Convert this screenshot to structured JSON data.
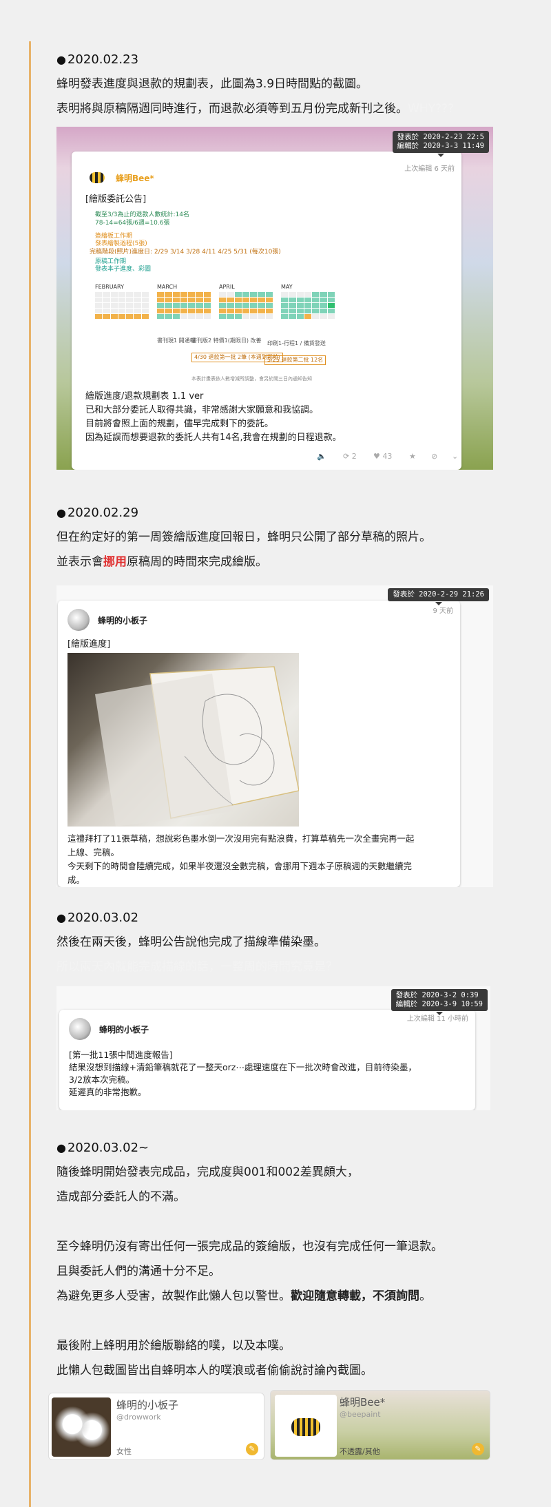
{
  "sections": [
    {
      "date": "2020.02.23",
      "lines": [
        "蜂明發表進度與退款的規劃表，此圖為3.9日時間點的截圖。",
        "表明將與原稿隔週同時進行，而退款必須等到五月份完成新刊之後。"
      ],
      "whisper": "WHY???"
    },
    {
      "date": "2020.02.29",
      "line1": "但在約定好的第一周簽繪版進度回報日，蜂明只公開了部分草稿的照片。",
      "line2_pre": "並表示會",
      "line2_red": "挪用",
      "line2_post": "原稿周的時間來完成繪版。"
    },
    {
      "date": "2020.03.02",
      "line1": "然後在兩天後，蜂明公告說他完成了描線準備染墨。",
      "whisper": "所以兩天內就能完成描線的話，一整周的時間究竟是？"
    },
    {
      "date": "2020.03.02~",
      "lines": [
        "隨後蜂明開始發表完成品，完成度與001和002差異頗大，",
        "造成部分委託人的不滿。",
        "",
        "至今蜂明仍沒有寄出任何一張完成品的簽繪版，也沒有完成任何一筆退款。",
        "且與委託人們的溝通十分不足。"
      ],
      "warn_pre": "為避免更多人受害，故製作此懶人包以警世。",
      "warn_bold": "歡迎隨意轉載，不須詢問",
      "warn_post": "。",
      "lines2": [
        "",
        "最後附上蜂明用於繪版聯絡的噗，以及本噗。",
        "此懶人包截圖皆出自蜂明本人的噗浪或者偷偷說討論內截圖。"
      ]
    }
  ],
  "shot1": {
    "ts": [
      "發表於 2020-2-23 22:5",
      "編輯於 2020-3-3 11:49"
    ],
    "edited": "上次編輯 6 天前",
    "user": "蜂明Bee*",
    "title": "[繪版委託公告]",
    "stats": [
      "截至3/3為止的退款人數統計:14名",
      "78-14=64張/6週=10.6張"
    ],
    "legend": [
      "簽繪板工作期",
      "發表繪製過程(5張)",
      "完稿階段(照片)進度日: 2/29  3/14  3/28  4/11  4/25  5/31 (每次10張)",
      "原稿工作期",
      "發表本子進度、彩圖"
    ],
    "months": [
      "FEBRUARY",
      "MARCH",
      "APRIL",
      "MAY"
    ],
    "notes": [
      "書刊現1 開通報",
      "書刊版2 特價1(期限日) 改善",
      "印刷1-行程1 / 備貨發送",
      "4/30 退款第一批 2筆 (本週到期前)",
      "5/25 退款第二批 12名"
    ],
    "footer": "本表計畫表依人數增減所調整，會另於開三日內通知告知",
    "body": [
      "繪版進度/退款規劃表 1.1 ver",
      "已和大部分委託人取得共識，非常感謝大家願意和我協調。",
      "目前將會照上面的規劃，儘早完成剩下的委託。",
      "因為延誤而想要退款的委託人共有14名,我會在規劃的日程退款。"
    ],
    "actions": {
      "replies": "2",
      "likes": "43"
    }
  },
  "shot2": {
    "ts": [
      "發表於 2020-2-29 21:26"
    ],
    "ago": "9 天前",
    "user": "蜂明的小板子",
    "title": "[繪版進度]",
    "body": [
      "這禮拜打了11張草稿，想說彩色墨水倒一次沒用完有點浪費，打算草稿先一次全畫完再一起",
      "上線、完稿。",
      "今天剩下的時間會陸續完成，如果半夜還沒全數完稿，會挪用下週本子原稿週的天數繼續完",
      "成。"
    ]
  },
  "shot3": {
    "ts": [
      "發表於 2020-3-2 0:39",
      "編輯於 2020-3-9 10:59"
    ],
    "edited": "上次編輯 11 小時前",
    "user": "蜂明的小板子",
    "body": [
      "[第一批11張中間進度報告]",
      "結果沒想到描線+清鉛筆稿就花了一整天orz⋯處理速度在下一批次時會改進，目前待染墨，",
      "3/2放本次完稿。",
      "延遲真的非常抱歉。"
    ]
  },
  "profiles": [
    {
      "name": "蜂明的小板子",
      "handle": "@drowwork",
      "meta": "女性"
    },
    {
      "name": "蜂明Bee*",
      "handle": "@beepaint",
      "meta": "不透露/其他"
    }
  ],
  "colors": {
    "accent": "#e8b36a",
    "highlight": "#e03030"
  }
}
